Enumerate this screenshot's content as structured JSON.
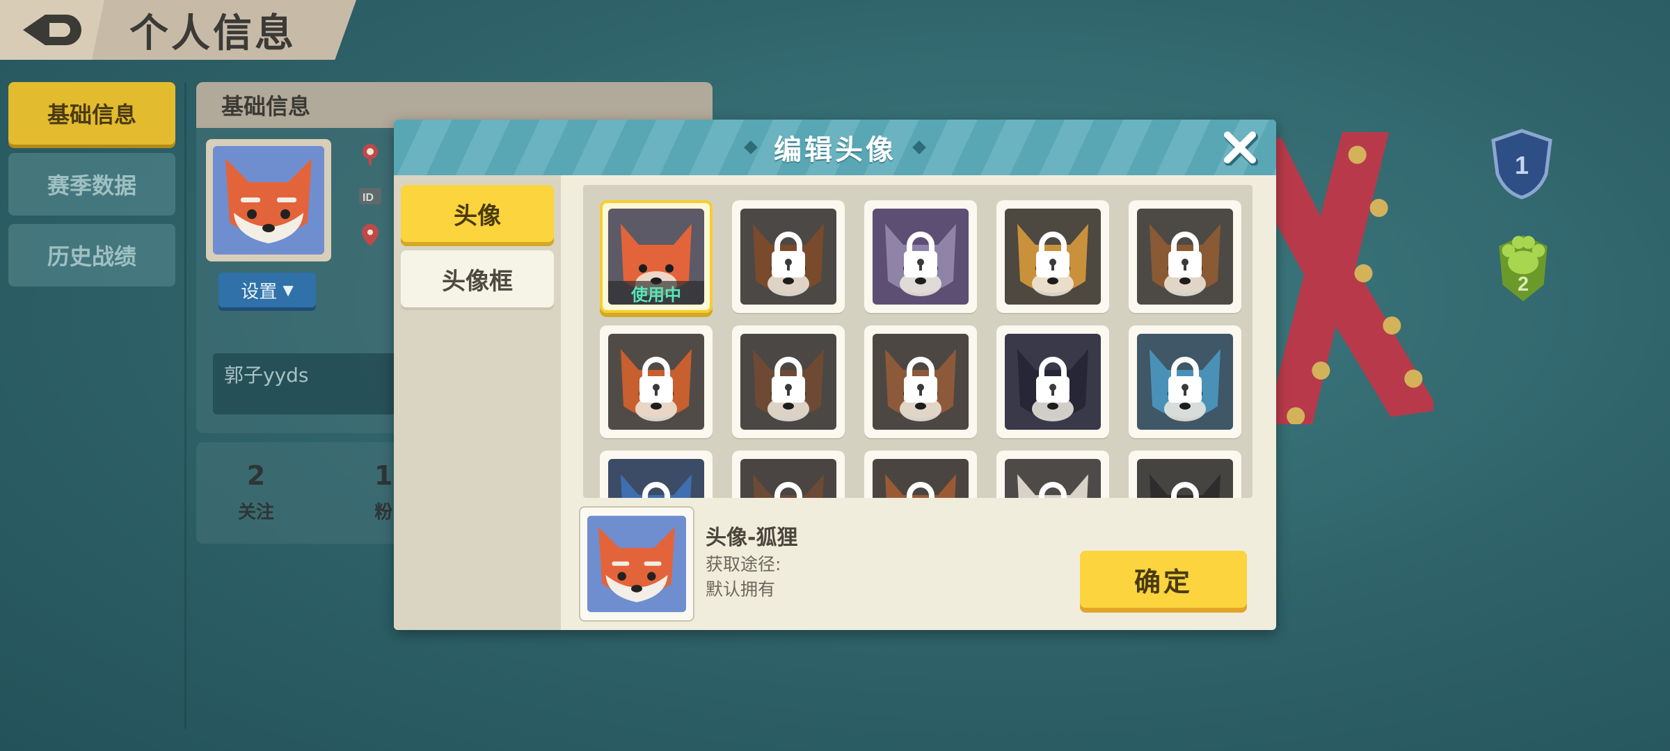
{
  "page": {
    "title": "个人信息"
  },
  "nav": {
    "items": [
      {
        "label": "基础信息",
        "active": true
      },
      {
        "label": "赛季数据",
        "active": false
      },
      {
        "label": "历史战绩",
        "active": false
      }
    ]
  },
  "info": {
    "header": "基础信息",
    "settings_label": "设置",
    "signature": "郭子yyds",
    "stats": [
      {
        "num": "2",
        "label": "关注"
      },
      {
        "num": "1",
        "label": "粉"
      }
    ]
  },
  "badges": [
    {
      "value": "1",
      "icon": "shield-badge-icon"
    },
    {
      "value": "2",
      "icon": "paw-badge-icon"
    }
  ],
  "modal": {
    "title": "编辑头像",
    "tabs": [
      {
        "label": "头像",
        "active": true
      },
      {
        "label": "头像框",
        "active": false
      }
    ],
    "in_use_label": "使用中",
    "avatars": [
      {
        "name": "fox",
        "bg": "#5c5a66",
        "color": "#e3643a",
        "locked": false,
        "selected": true
      },
      {
        "name": "bear",
        "bg": "#4c4846",
        "color": "#7a4a2c",
        "locked": true
      },
      {
        "name": "cat",
        "bg": "#5d4f74",
        "color": "#8f83a8",
        "locked": true
      },
      {
        "name": "tiger",
        "bg": "#4d4840",
        "color": "#c9913c",
        "locked": true
      },
      {
        "name": "deer",
        "bg": "#4d4a46",
        "color": "#8a5a34",
        "locked": true
      },
      {
        "name": "calico-cat",
        "bg": "#514b47",
        "color": "#c75f2f",
        "locked": true
      },
      {
        "name": "dog",
        "bg": "#4a4744",
        "color": "#6e4a34",
        "locked": true
      },
      {
        "name": "rabbit",
        "bg": "#4d4743",
        "color": "#8c5a3a",
        "locked": true
      },
      {
        "name": "black-cat",
        "bg": "#3a394a",
        "color": "#262636",
        "locked": true
      },
      {
        "name": "penguin",
        "bg": "#3f5766",
        "color": "#4a91b7",
        "locked": true
      },
      {
        "name": "bird",
        "bg": "#3c4c66",
        "color": "#3f6fb0",
        "locked": true
      },
      {
        "name": "mouse",
        "bg": "#4a4542",
        "color": "#6b4a36",
        "locked": true
      },
      {
        "name": "squirrel",
        "bg": "#4b4541",
        "color": "#9a5b34",
        "locked": true
      },
      {
        "name": "chicken",
        "bg": "#4d4a48",
        "color": "#d8d2c8",
        "locked": true
      },
      {
        "name": "cow",
        "bg": "#464441",
        "color": "#2e2c2c",
        "locked": true
      }
    ],
    "detail": {
      "name": "头像-狐狸",
      "source_label": "获取途径:",
      "source": "默认拥有"
    },
    "confirm_label": "确定"
  }
}
